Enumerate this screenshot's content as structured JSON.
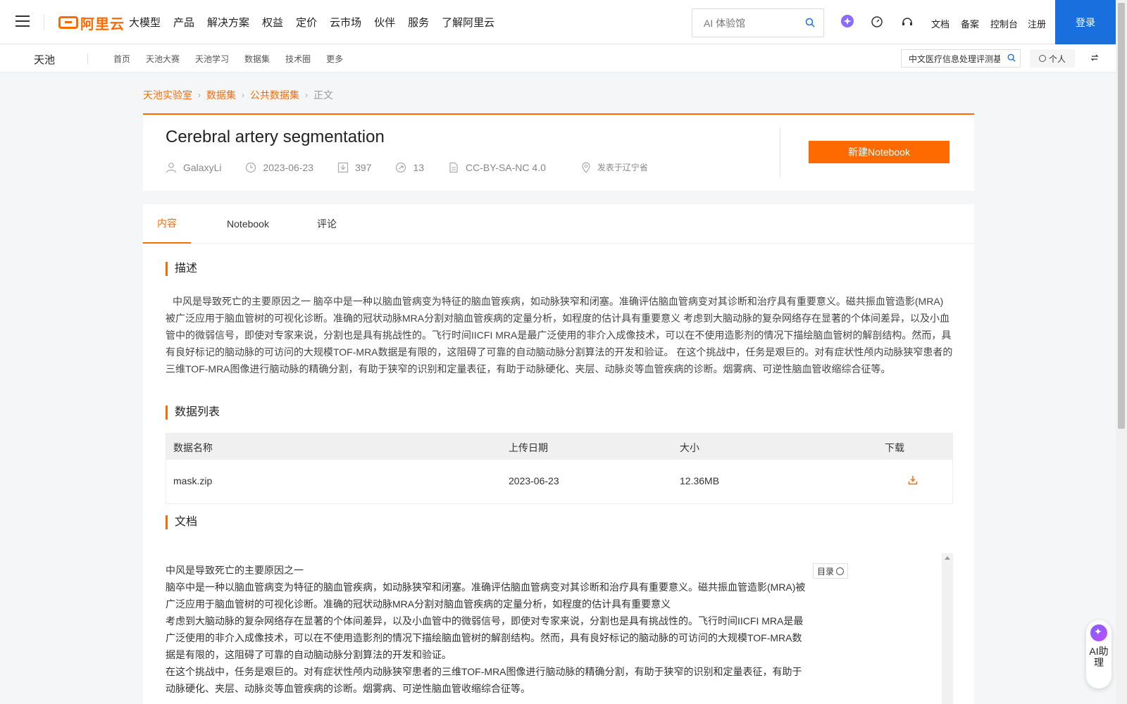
{
  "topnav": {
    "logo_text": "阿里云",
    "menu": [
      "大模型",
      "产品",
      "解决方案",
      "权益",
      "定价",
      "云市场",
      "伙伴",
      "服务",
      "了解阿里云"
    ],
    "search_placeholder": "AI 体验馆",
    "links": [
      "文档",
      "备案",
      "控制台",
      "注册"
    ],
    "login": "登录"
  },
  "subnav": {
    "brand": "天池",
    "menu": [
      "首页",
      "天池大赛",
      "天池学习",
      "数据集",
      "技术圈",
      "更多"
    ],
    "search_value": "中文医疗信息处理评测基",
    "personal": "个人"
  },
  "breadcrumb": [
    "天池实验室",
    "数据集",
    "公共数据集",
    "正文"
  ],
  "dataset": {
    "title": "Cerebral artery segmentation",
    "author": "GalaxyLi",
    "date": "2023-06-23",
    "downloads": "397",
    "shares": "13",
    "license": "CC-BY-SA-NC 4.0",
    "location": "发表于辽宁省",
    "new_notebook": "新建Notebook"
  },
  "tabs": [
    "内容",
    "Notebook",
    "评论"
  ],
  "sections": {
    "description_title": "描述",
    "description": "中风是导致死亡的主要原因之一 脑卒中是一种以脑血管病变为特征的脑血管疾病，如动脉狭窄和闭塞。准确评估脑血管病变对其诊断和治疗具有重要意义。磁共振血管造影(MRA)被广泛应用于脑血管树的可视化诊断。准确的冠状动脉MRA分割对脑血管疾病的定量分析，如程度的估计具有重要意义 考虑到大脑动脉的复杂网络存在显著的个体间差异，以及小血管中的微弱信号，即使对专家来说，分割也是具有挑战性的。飞行时间IICFI MRA是最广泛使用的非介入成像技术，可以在不使用造影剂的情况下描绘脑血管树的解剖结构。然而，具有良好标记的脑动脉的可访问的大规模TOF-MRA数据是有限的，这阻碍了可靠的自动脑动脉分割算法的开发和验证。 在这个挑战中，任务是艰巨的。对有症状性颅内动脉狭窄患者的三维TOF-MRA图像进行脑动脉的精确分割，有助于狭窄的识别和定量表征，有助于动脉硬化、夹层、动脉炎等血管疾病的诊断。烟雾病、可逆性脑血管收缩综合征等。",
    "datalist_title": "数据列表",
    "doc_title": "文档"
  },
  "table": {
    "headers": [
      "数据名称",
      "上传日期",
      "大小",
      "下载"
    ],
    "rows": [
      {
        "name": "mask.zip",
        "date": "2023-06-23",
        "size": "12.36MB"
      }
    ]
  },
  "doc": {
    "lines": [
      "中风是导致死亡的主要原因之一",
      "脑卒中是一种以脑血管病变为特征的脑血管疾病，如动脉狭窄和闭塞。准确评估脑血管病变对其诊断和治疗具有重要意义。磁共振血管造影(MRA)被广泛应用于脑血管树的可视化诊断。准确的冠状动脉MRA分割对脑血管疾病的定量分析，如程度的估计具有重要意义",
      "考虑到大脑动脉的复杂网络存在显著的个体间差异，以及小血管中的微弱信号，即使对专家来说，分割也是具有挑战性的。飞行时间IICFI MRA是最广泛使用的非介入成像技术，可以在不使用造影剂的情况下描绘脑血管树的解剖结构。然而，具有良好标记的脑动脉的可访问的大规模TOF-MRA数据是有限的，这阻碍了可靠的自动脑动脉分割算法的开发和验证。",
      "在这个挑战中，任务是艰巨的。对有症状性颅内动脉狭窄患者的三维TOF-MRA图像进行脑动脉的精确分割，有助于狭窄的识别和定量表征，有助于动脉硬化、夹层、动脉炎等血管疾病的诊断。烟雾病、可逆性脑血管收缩综合征等。"
    ],
    "toc": "目录"
  },
  "ai_helper": "AI助理",
  "colors": {
    "accent": "#ff6a00",
    "login_blue": "#1a6fde"
  }
}
